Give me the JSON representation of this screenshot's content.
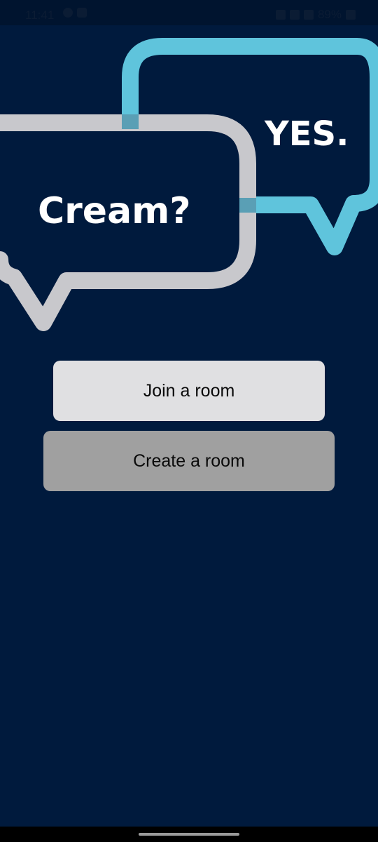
{
  "status_bar": {
    "time": "11:41",
    "battery": "89%",
    "left_icons": [
      "whatsapp-icon",
      "gallery-icon"
    ],
    "right_icons": [
      "mute-icon",
      "wifi-icon",
      "signal-icon",
      "battery-icon"
    ]
  },
  "logo": {
    "question": "Cream?",
    "answer": "YES.",
    "colors": {
      "question_bubble": "#c8c8cc",
      "answer_bubble": "#5fc4dc",
      "background": "#001a3d"
    }
  },
  "actions": {
    "join_label": "Join a room",
    "create_label": "Create a room"
  }
}
